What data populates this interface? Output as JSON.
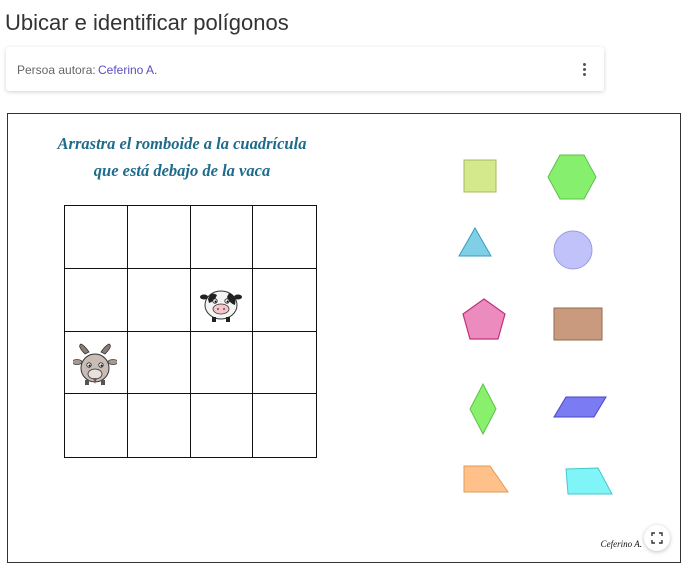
{
  "page": {
    "title": "Ubicar e identificar polígonos"
  },
  "author": {
    "label": "Persoa autora:",
    "name": "Ceferino A."
  },
  "menu": {
    "icon": "more-vertical-icon"
  },
  "applet": {
    "instruction_line1": "Arrastra el romboide a la cuadrícula",
    "instruction_line2": "que está debajo de la vaca",
    "grid": {
      "rows": 4,
      "cols": 4,
      "cow_cell": [
        1,
        2
      ],
      "goat_cell": [
        2,
        0
      ]
    },
    "signature": "Ceferino A.",
    "shapes": [
      {
        "name": "square",
        "color": "#d4e88c"
      },
      {
        "name": "hexagon",
        "color": "#86f06e"
      },
      {
        "name": "triangle",
        "color": "#7fd0e6"
      },
      {
        "name": "circle",
        "color": "#c2c2fa"
      },
      {
        "name": "pentagon",
        "color": "#ec8cbe"
      },
      {
        "name": "rectangle",
        "color": "#c99a7e"
      },
      {
        "name": "rhombus",
        "color": "#88f06a"
      },
      {
        "name": "rhomboid",
        "color": "#7b7bf4"
      },
      {
        "name": "trapezoid",
        "color": "#ffc189"
      },
      {
        "name": "irregular-quadrilateral",
        "color": "#80f5f7"
      }
    ],
    "fullscreen_icon": "fullscreen-icon"
  }
}
